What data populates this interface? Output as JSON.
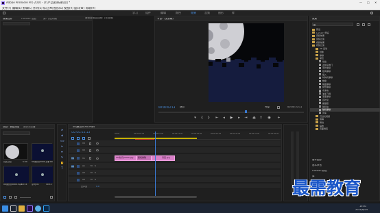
{
  "app": {
    "title": "Adobe Premiere Pro 2020 - D:\\产品图\\新建项目 *"
  },
  "menu": [
    "文件(F)",
    "编辑(E)",
    "剪辑(C)",
    "序列(S)",
    "标记(M)",
    "图形(G)",
    "视图(V)",
    "窗口(W)",
    "帮助(H)"
  ],
  "workspaces": [
    "学习",
    "组件",
    "编辑",
    "颜色",
    "效果",
    "音频",
    "图形",
    "库"
  ],
  "active_workspace": "效果",
  "left_panel": {
    "tabs": [
      "效果控件",
      "Lumetri 范围",
      "源：(无剪辑)",
      "音频剪辑混合器：(无剪辑)"
    ],
    "empty_msg": "(未选择剪辑)"
  },
  "program": {
    "tab": "节目：(无剪辑)",
    "timecode": "00:00:03:13",
    "fit": "适合",
    "quality": "完整",
    "duration": "00:00:10:11"
  },
  "effects": {
    "title": "效果",
    "items": [
      {
        "label": "预设",
        "type": "folder",
        "indent": 0
      },
      {
        "label": "Lumetri 预设",
        "type": "folder",
        "indent": 0
      },
      {
        "label": "音频效果",
        "type": "folder",
        "indent": 0
      },
      {
        "label": "音频过渡",
        "type": "folder",
        "indent": 0
      },
      {
        "label": "视频效果",
        "type": "folder",
        "indent": 0
      },
      {
        "label": "视频过渡",
        "type": "folder",
        "indent": 0
      },
      {
        "label": "3D 运动",
        "type": "folder",
        "indent": 1
      },
      {
        "label": "划像",
        "type": "folder",
        "indent": 1
      },
      {
        "label": "擦除",
        "type": "folder",
        "indent": 1
      },
      {
        "label": "渐隐",
        "type": "folder",
        "indent": 1
      },
      {
        "label": "划出",
        "type": "fx",
        "indent": 2
      },
      {
        "label": "双侧平推门",
        "type": "fx",
        "indent": 2
      },
      {
        "label": "带状擦除",
        "type": "fx",
        "indent": 2
      },
      {
        "label": "径向擦除",
        "type": "fx",
        "indent": 2
      },
      {
        "label": "插入",
        "type": "fx",
        "indent": 2
      },
      {
        "label": "时钟式擦除",
        "type": "fx",
        "indent": 2
      },
      {
        "label": "棋盘",
        "type": "fx",
        "indent": 2
      },
      {
        "label": "棋盘擦除",
        "type": "fx",
        "indent": 2
      },
      {
        "label": "楔形擦除",
        "type": "fx",
        "indent": 2
      },
      {
        "label": "水波块",
        "type": "fx",
        "indent": 2
      },
      {
        "label": "油漆飞溅",
        "type": "fx",
        "indent": 2
      },
      {
        "label": "渐变擦除",
        "type": "fx",
        "indent": 2
      },
      {
        "label": "百叶窗",
        "type": "fx",
        "indent": 2
      },
      {
        "label": "螺旋框",
        "type": "fx",
        "indent": 2
      },
      {
        "label": "随机块",
        "type": "fx",
        "indent": 2
      },
      {
        "label": "随机擦除",
        "type": "fx",
        "indent": 2,
        "selected": true
      },
      {
        "label": "风车",
        "type": "fx",
        "indent": 2
      },
      {
        "label": "沉浸式视频",
        "type": "folder",
        "indent": 1
      },
      {
        "label": "溶解",
        "type": "folder",
        "indent": 1
      },
      {
        "label": "滑动",
        "type": "folder",
        "indent": 1
      },
      {
        "label": "缩放",
        "type": "folder",
        "indent": 1
      },
      {
        "label": "页面剥落",
        "type": "folder",
        "indent": 1
      }
    ],
    "bottom_sections": [
      "基本图形",
      "基本声音",
      "Lumetri 颜色",
      "库",
      "标记",
      "历史记录",
      "信息"
    ]
  },
  "project": {
    "tabs": [
      "项目：新建项目",
      "媒体浏览器"
    ],
    "search": "",
    "items": [
      {
        "name": "月亮.jpg",
        "dur": "5:00"
      },
      {
        "name": "00(秋月)0000.jpg",
        "dur": "5:00"
      },
      {
        "name": "00(秋月)0000.mp4",
        "dur": "10:11"
      },
      {
        "name": "序列 01",
        "dur": "10:11"
      }
    ]
  },
  "timeline": {
    "tab": "00(秋月)0000.mp4",
    "timecode": "00:00:03:13",
    "ruler": [
      "00:00",
      "00:00:05:00",
      "00:00:10:00",
      "00:00:15:00",
      "00:00:20:00",
      "00:00:25:00",
      "00:00:30:00",
      "00:00:35:00",
      "00:00:40:00"
    ],
    "tracks": [
      "V3",
      "V2",
      "V1",
      "A1",
      "A2",
      "A3"
    ],
    "master": "主声道",
    "master_val": "0.0",
    "clips": [
      {
        "label": "00(秋月)0000.jpg",
        "track": "V1"
      },
      {
        "label": "随机擦除",
        "track": "V1"
      },
      {
        "label": "月亮.jpg",
        "track": "V1"
      }
    ]
  },
  "watermark": "最需教育",
  "taskbar": {
    "time": "15:01",
    "date": "2021/6/24"
  },
  "colors": {
    "accent": "#4a90e2",
    "clip": "#d97fc8",
    "playhead": "#3a7bd5"
  }
}
